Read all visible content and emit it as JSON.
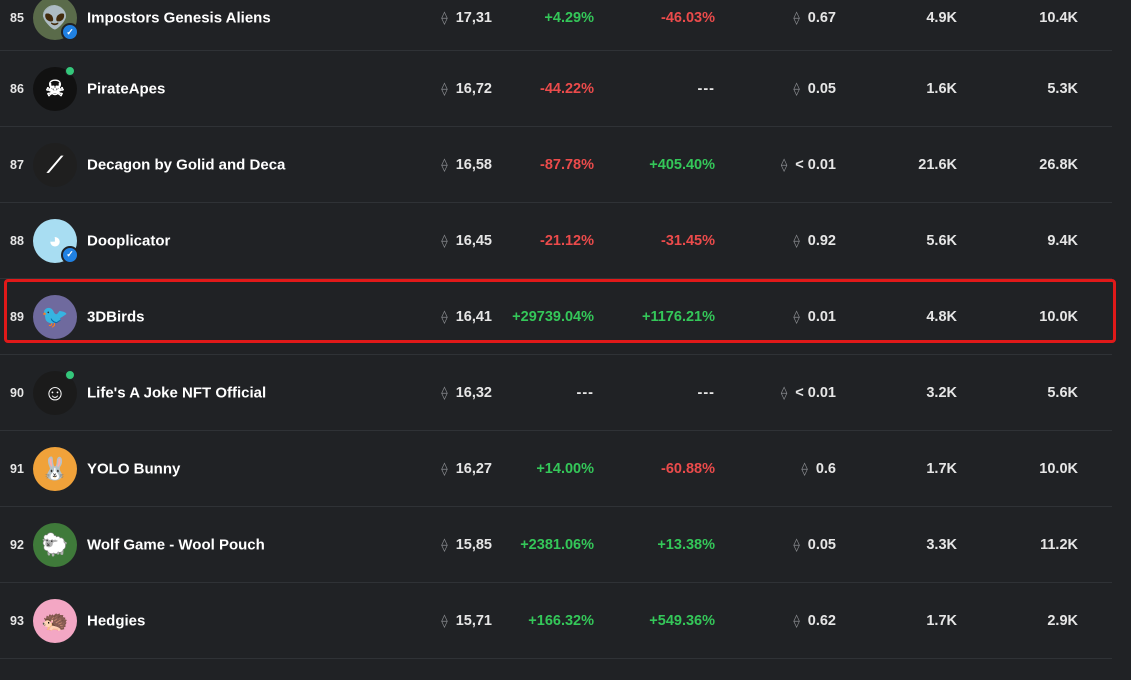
{
  "eth_symbol": "⟠",
  "colors": {
    "positive": "#34c759",
    "negative": "#eb4b4b",
    "highlight_border": "#e01919",
    "background": "#202225"
  },
  "rows": [
    {
      "rank": "85",
      "name": "Impostors Genesis Aliens",
      "avatar_icon": "alien-avatar-icon",
      "avatar_bg": "#5a6b4a",
      "avatar_glyph": "👽",
      "verified": true,
      "online": false,
      "volume": "17,31",
      "change_24h": "+4.29%",
      "change_24h_sign": "pos",
      "change_7d": "-46.03%",
      "change_7d_sign": "neg",
      "floor": "0.67",
      "floor_prefix": "",
      "owners": "4.9K",
      "items": "10.4K",
      "highlighted": false
    },
    {
      "rank": "86",
      "name": "PirateApes",
      "avatar_icon": "skull-avatar-icon",
      "avatar_bg": "#111111",
      "avatar_glyph": "☠",
      "verified": false,
      "online": true,
      "volume": "16,72",
      "change_24h": "-44.22%",
      "change_24h_sign": "neg",
      "change_7d": "---",
      "change_7d_sign": "nil",
      "floor": "0.05",
      "floor_prefix": "",
      "owners": "1.6K",
      "items": "5.3K",
      "highlighted": false
    },
    {
      "rank": "87",
      "name": "Decagon by Golid and Deca",
      "avatar_icon": "stripes-avatar-icon",
      "avatar_bg": "#1f1f1f",
      "avatar_glyph": "⟋",
      "verified": false,
      "online": false,
      "volume": "16,58",
      "change_24h": "-87.78%",
      "change_24h_sign": "neg",
      "change_7d": "+405.40%",
      "change_7d_sign": "pos",
      "floor": "0.01",
      "floor_prefix": "< ",
      "owners": "21.6K",
      "items": "26.8K",
      "highlighted": false
    },
    {
      "rank": "88",
      "name": "Dooplicator",
      "avatar_icon": "dooplicator-avatar-icon",
      "avatar_bg": "#a8ddf2",
      "avatar_glyph": "◕",
      "verified": true,
      "online": false,
      "volume": "16,45",
      "change_24h": "-21.12%",
      "change_24h_sign": "neg",
      "change_7d": "-31.45%",
      "change_7d_sign": "neg",
      "floor": "0.92",
      "floor_prefix": "",
      "owners": "5.6K",
      "items": "9.4K",
      "highlighted": false
    },
    {
      "rank": "89",
      "name": "3DBirds",
      "avatar_icon": "bird-avatar-icon",
      "avatar_bg": "#6f6a9e",
      "avatar_glyph": "🐦",
      "verified": false,
      "online": false,
      "volume": "16,41",
      "change_24h": "+29739.04%",
      "change_24h_sign": "pos",
      "change_7d": "+1176.21%",
      "change_7d_sign": "pos",
      "floor": "0.01",
      "floor_prefix": "",
      "owners": "4.8K",
      "items": "10.0K",
      "highlighted": true
    },
    {
      "rank": "90",
      "name": "Life's A Joke NFT Official",
      "avatar_icon": "sketch-face-avatar-icon",
      "avatar_bg": "#1b1b1b",
      "avatar_glyph": "☺",
      "verified": false,
      "online": true,
      "volume": "16,32",
      "change_24h": "---",
      "change_24h_sign": "nil",
      "change_7d": "---",
      "change_7d_sign": "nil",
      "floor": "0.01",
      "floor_prefix": "< ",
      "owners": "3.2K",
      "items": "5.6K",
      "highlighted": false
    },
    {
      "rank": "91",
      "name": "YOLO Bunny",
      "avatar_icon": "bunny-avatar-icon",
      "avatar_bg": "#f0a23a",
      "avatar_glyph": "🐰",
      "verified": false,
      "online": false,
      "volume": "16,27",
      "change_24h": "+14.00%",
      "change_24h_sign": "pos",
      "change_7d": "-60.88%",
      "change_7d_sign": "neg",
      "floor": "0.6",
      "floor_prefix": "",
      "owners": "1.7K",
      "items": "10.0K",
      "highlighted": false
    },
    {
      "rank": "92",
      "name": "Wolf Game - Wool Pouch",
      "avatar_icon": "wool-pouch-avatar-icon",
      "avatar_bg": "#3f7a3a",
      "avatar_glyph": "🐑",
      "verified": false,
      "online": false,
      "volume": "15,85",
      "change_24h": "+2381.06%",
      "change_24h_sign": "pos",
      "change_7d": "+13.38%",
      "change_7d_sign": "pos",
      "floor": "0.05",
      "floor_prefix": "",
      "owners": "3.3K",
      "items": "11.2K",
      "highlighted": false
    },
    {
      "rank": "93",
      "name": "Hedgies",
      "avatar_icon": "hedgehog-avatar-icon",
      "avatar_bg": "#f3a7c4",
      "avatar_glyph": "🦔",
      "verified": false,
      "online": false,
      "volume": "15,71",
      "change_24h": "+166.32%",
      "change_24h_sign": "pos",
      "change_7d": "+549.36%",
      "change_7d_sign": "pos",
      "floor": "0.62",
      "floor_prefix": "",
      "owners": "1.7K",
      "items": "2.9K",
      "highlighted": false
    }
  ]
}
